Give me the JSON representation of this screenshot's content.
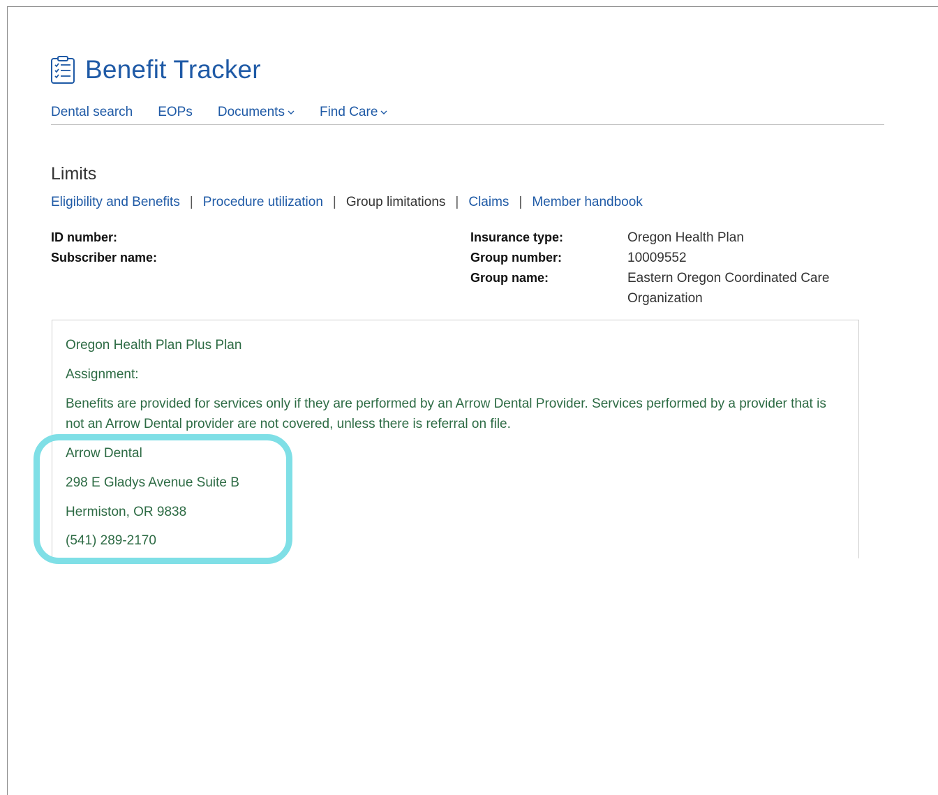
{
  "app": {
    "title": "Benefit Tracker",
    "title_icon": "checklist-icon"
  },
  "top_nav": {
    "items": [
      {
        "label": "Dental search",
        "dropdown": false
      },
      {
        "label": "EOPs",
        "dropdown": false
      },
      {
        "label": "Documents",
        "dropdown": true
      },
      {
        "label": "Find Care",
        "dropdown": true
      }
    ]
  },
  "section": {
    "title": "Limits"
  },
  "sub_nav": {
    "items": [
      {
        "label": "Eligibility and Benefits",
        "active": false
      },
      {
        "label": "Procedure utilization",
        "active": false
      },
      {
        "label": "Group limitations",
        "active": true
      },
      {
        "label": "Claims",
        "active": false
      },
      {
        "label": "Member handbook",
        "active": false
      }
    ],
    "separator": "|"
  },
  "member_info": {
    "id_label": "ID number:",
    "subscriber_label": "Subscriber name:",
    "insurance_type_label": "Insurance type:",
    "insurance_type_value": "Oregon Health Plan",
    "group_number_label": "Group number:",
    "group_number_value": "10009552",
    "group_name_label": "Group name:",
    "group_name_value": "Eastern Oregon Coordinated Care Organization"
  },
  "plan": {
    "name": "Oregon Health Plan Plus Plan",
    "assignment_label": "Assignment:",
    "benefits_text": "Benefits are provided for services only if they are performed by an Arrow Dental Provider. Services performed by a provider that is not an Arrow Dental provider are not covered, unless there is referral on file.",
    "provider": {
      "name": "Arrow Dental",
      "street": "298 E Gladys Avenue Suite B",
      "city": "Hermiston, OR 9838",
      "phone": "(541) 289-2170"
    }
  },
  "colors": {
    "link_blue": "#1f5aa6",
    "plan_text_green": "#2d6b44",
    "highlight_cyan": "#7fdfe6"
  }
}
